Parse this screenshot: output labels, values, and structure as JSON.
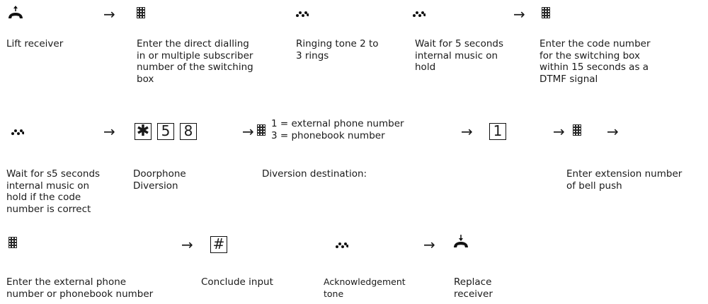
{
  "row1": {
    "arrow": "→",
    "steps": [
      {
        "icon": "handset-lift-icon",
        "text": "Lift receiver"
      },
      {
        "icon": "keypad-icon",
        "text": "Enter the direct dialling\nin or multiple subscriber\nnumber of the switching\nbox"
      },
      {
        "icon": "tone-icon",
        "text": "Ringing tone 2 to\n3 rings"
      },
      {
        "icon": "tone-icon",
        "text": "Wait for 5 seconds\ninternal music on\nhold"
      },
      {
        "icon": "keypad-icon",
        "text": "Enter the code number\nfor the switching box\nwithin 15 seconds as a\nDTMF signal"
      }
    ]
  },
  "row2": {
    "arrow": "→",
    "keys_code": [
      "✱",
      "5",
      "8"
    ],
    "options": [
      "1 = external phone number",
      "3 = phonebook number"
    ],
    "key_select": "1",
    "captions": {
      "wait": "Wait for s5 seconds\ninternal music on\nhold if the code\nnumber is correct",
      "doorphone": "Doorphone\nDiversion",
      "destination": "Diversion destination:",
      "extension": "Enter extension number\nof bell push"
    }
  },
  "row3": {
    "arrow": "→",
    "key_hash": "#",
    "captions": {
      "external": "Enter the external phone\nnumber or phonebook number",
      "conclude": "Conclude input",
      "ack": "Acknowledgement\ntone",
      "replace": "Replace\nreceiver"
    }
  }
}
